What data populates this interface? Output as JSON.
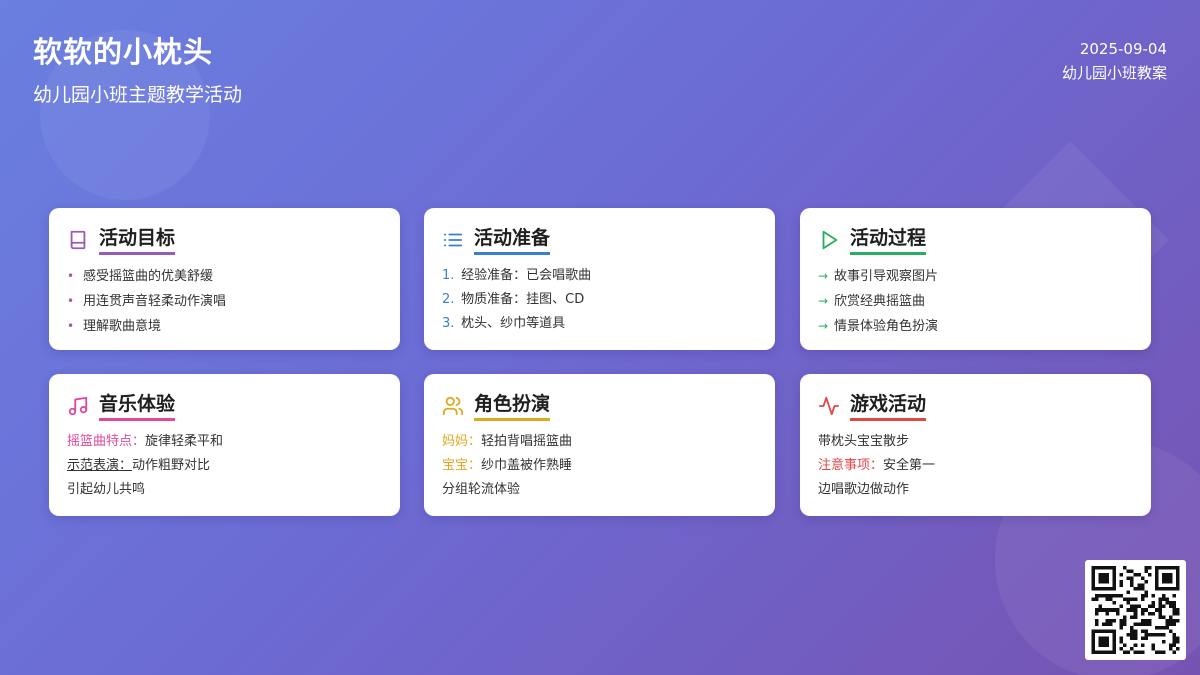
{
  "header": {
    "title": "软软的小枕头",
    "subtitle": "幼儿园小班主题教学活动",
    "date": "2025-09-04",
    "doc_type": "幼儿园小班教案"
  },
  "colors": {
    "goal": "#9b59b6",
    "prep": "#3b7fd0",
    "process": "#27ae60",
    "music": "#e0499a",
    "role": "#e0a81c",
    "game": "#e04848"
  },
  "cards": {
    "goal": {
      "icon": "book-icon",
      "title": "活动目标",
      "bullet": "•",
      "items": [
        "感受摇篮曲的优美舒缓",
        "用连贯声音轻柔动作演唱",
        "理解歌曲意境"
      ]
    },
    "prep": {
      "icon": "list-icon",
      "title": "活动准备",
      "items": [
        {
          "num": "1.",
          "text": "经验准备：已会唱歌曲"
        },
        {
          "num": "2.",
          "text": "物质准备：挂图、CD"
        },
        {
          "num": "3.",
          "text": "枕头、纱巾等道具"
        }
      ]
    },
    "process": {
      "icon": "play-icon",
      "title": "活动过程",
      "arrow": "→",
      "items": [
        "故事引导观察图片",
        "欣赏经典摇篮曲",
        "情景体验角色扮演"
      ]
    },
    "music": {
      "icon": "music-note-icon",
      "title": "音乐体验",
      "rows": [
        {
          "label": "摇篮曲特点：",
          "text": "旋律轻柔平和"
        },
        {
          "label": "示范表演：",
          "text": "动作粗野对比"
        },
        {
          "text": "引起幼儿共鸣"
        }
      ]
    },
    "role": {
      "icon": "users-icon",
      "title": "角色扮演",
      "rows": [
        {
          "label": "妈妈：",
          "text": "轻拍背唱摇篮曲"
        },
        {
          "label": "宝宝：",
          "text": "纱巾盖被作熟睡"
        },
        {
          "text": "分组轮流体验"
        }
      ]
    },
    "game": {
      "icon": "activity-icon",
      "title": "游戏活动",
      "rows": [
        {
          "text": "带枕头宝宝散步"
        },
        {
          "label": "注意事项：",
          "text": "安全第一"
        },
        {
          "text": "边唱歌边做动作"
        }
      ]
    }
  },
  "qr": {
    "icon": "qr-code-icon"
  }
}
